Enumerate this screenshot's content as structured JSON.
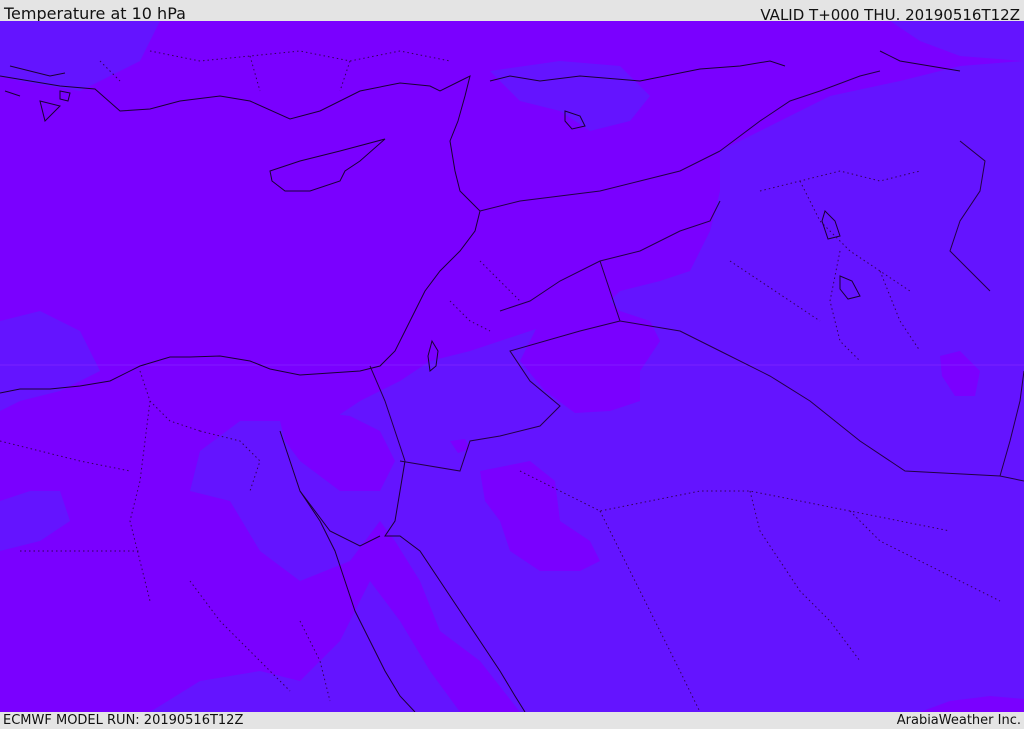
{
  "header": {
    "title": "Temperature at 10 hPa",
    "valid": "VALID T+000 THU. 20190516T12Z"
  },
  "footer": {
    "model_run": "ECMWF MODEL RUN: 20190516T12Z",
    "credit": "ArabiaWeather Inc."
  },
  "map": {
    "colors": {
      "warm_band": "#7a00ff",
      "cool_band": "#6414ff",
      "coastline": "#1a0033",
      "border": "#220044"
    }
  }
}
